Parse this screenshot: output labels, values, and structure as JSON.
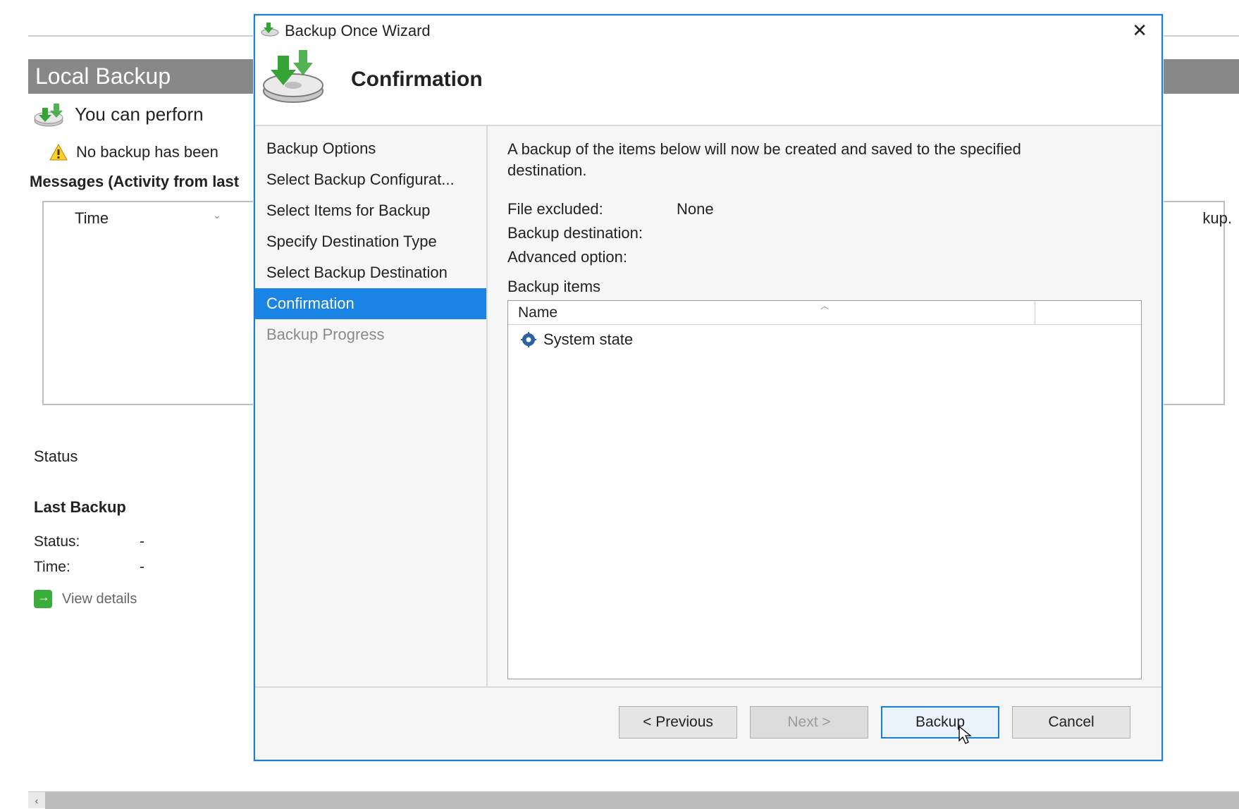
{
  "background": {
    "header": "Local Backup",
    "subheader": "You can perforn",
    "warn_text": "No backup has been",
    "right_trail": "kup.",
    "messages_label": "Messages (Activity from last",
    "time_col": "Time",
    "status_title": "Status",
    "last_backup_title": "Last Backup",
    "status_label": "Status:",
    "status_value": "-",
    "time_label": "Time:",
    "time_value": "-",
    "view_details": "View details"
  },
  "wizard": {
    "window_title": "Backup Once Wizard",
    "banner_title": "Confirmation",
    "steps": [
      {
        "label": "Backup Options",
        "state": "normal"
      },
      {
        "label": "Select Backup Configurat...",
        "state": "normal"
      },
      {
        "label": "Select Items for Backup",
        "state": "normal"
      },
      {
        "label": "Specify Destination Type",
        "state": "normal"
      },
      {
        "label": "Select Backup Destination",
        "state": "normal"
      },
      {
        "label": "Confirmation",
        "state": "active"
      },
      {
        "label": "Backup Progress",
        "state": "muted"
      }
    ],
    "description": "A backup of the items below will now be created and saved to the specified destination.",
    "file_excluded_label": "File excluded:",
    "file_excluded_value": "None",
    "backup_destination_label": "Backup destination:",
    "backup_destination_value": "",
    "advanced_option_label": "Advanced option:",
    "advanced_option_value": "",
    "backup_items_label": "Backup items",
    "items_column_name": "Name",
    "items": [
      {
        "name": "System state"
      }
    ],
    "buttons": {
      "previous": "< Previous",
      "next": "Next >",
      "backup": "Backup",
      "cancel": "Cancel"
    }
  }
}
